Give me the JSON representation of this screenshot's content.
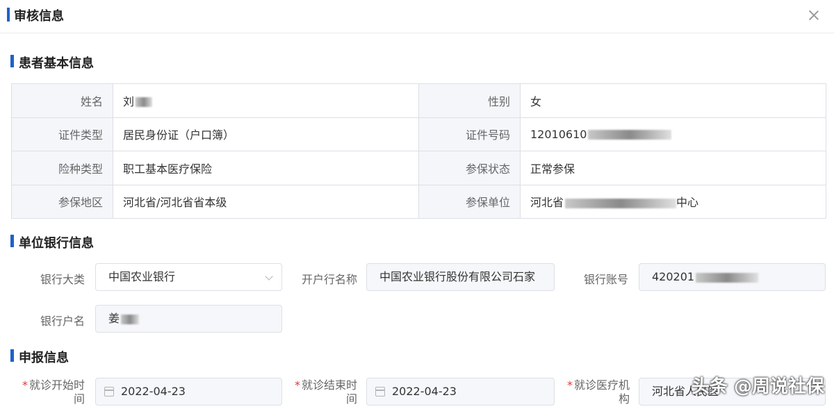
{
  "dialog": {
    "title": "审核信息"
  },
  "sections": {
    "patient": "患者基本信息",
    "bank": "单位银行信息",
    "declare": "申报信息"
  },
  "patient": {
    "name_label": "姓名",
    "name_value": "刘",
    "gender_label": "性别",
    "gender_value": "女",
    "id_type_label": "证件类型",
    "id_type_value": "居民身份证（户口簿）",
    "id_no_label": "证件号码",
    "id_no_value": "12010610",
    "insurance_type_label": "险种类型",
    "insurance_type_value": "职工基本医疗保险",
    "insurance_status_label": "参保状态",
    "insurance_status_value": "正常参保",
    "region_label": "参保地区",
    "region_value": "河北省/河北省省本级",
    "unit_label": "参保单位",
    "unit_value_prefix": "河北省",
    "unit_value_suffix": "中心"
  },
  "bank": {
    "category_label": "银行大类",
    "category_value": "中国农业银行",
    "branch_label": "开户行名称",
    "branch_value": "中国农业银行股份有限公司石家",
    "account_label": "银行账号",
    "account_value": "420201",
    "holder_label": "银行户名",
    "holder_value": "姜"
  },
  "declare": {
    "start_label": "就诊开始时间",
    "start_value": "2022-04-23",
    "end_label": "就诊结束时间",
    "end_value": "2022-04-23",
    "institution_label": "就诊医疗机构",
    "institution_value": "河北省人民医"
  },
  "watermark": "头条 @周说社保"
}
